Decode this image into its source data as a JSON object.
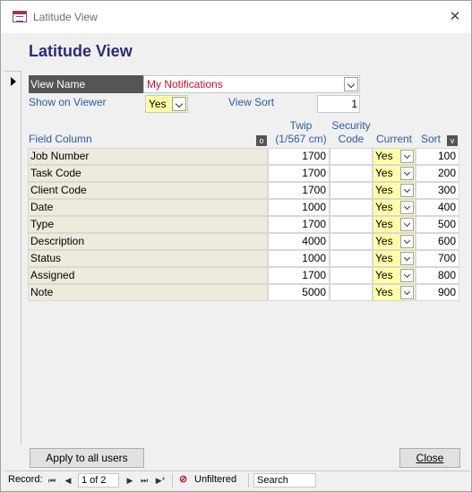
{
  "window": {
    "title": "Latitude View",
    "close_glyph": "✕"
  },
  "form": {
    "title": "Latitude View",
    "view_name_label": "View Name",
    "view_name_value": "My Notifications",
    "show_on_viewer_label": "Show on Viewer",
    "show_on_viewer_value": "Yes",
    "view_sort_label": "View Sort",
    "view_sort_value": "1"
  },
  "grid": {
    "headers": {
      "field_column": "Field Column",
      "o_button": "o",
      "twip_line1": "Twip",
      "twip_line2": "(1/567 cm)",
      "security_line1": "Security",
      "security_line2": "Code",
      "current": "Current",
      "sort": "Sort",
      "v_button": "v"
    },
    "rows": [
      {
        "field": "Job Number",
        "twip": "1700",
        "security": "",
        "current": "Yes",
        "sort": "100"
      },
      {
        "field": "Task Code",
        "twip": "1700",
        "security": "",
        "current": "Yes",
        "sort": "200"
      },
      {
        "field": "Client Code",
        "twip": "1700",
        "security": "",
        "current": "Yes",
        "sort": "300"
      },
      {
        "field": "Date",
        "twip": "1000",
        "security": "",
        "current": "Yes",
        "sort": "400"
      },
      {
        "field": "Type",
        "twip": "1700",
        "security": "",
        "current": "Yes",
        "sort": "500"
      },
      {
        "field": "Description",
        "twip": "4000",
        "security": "",
        "current": "Yes",
        "sort": "600"
      },
      {
        "field": "Status",
        "twip": "1000",
        "security": "",
        "current": "Yes",
        "sort": "700"
      },
      {
        "field": "Assigned",
        "twip": "1700",
        "security": "",
        "current": "Yes",
        "sort": "800"
      },
      {
        "field": "Note",
        "twip": "5000",
        "security": "",
        "current": "Yes",
        "sort": "900"
      }
    ]
  },
  "buttons": {
    "apply_all": "Apply to all users",
    "close": "Close"
  },
  "statusbar": {
    "record_label": "Record:",
    "first": "⏮",
    "prev": "◀",
    "record_value": "1 of 2",
    "next": "▶",
    "last": "⏭",
    "new": "▶*",
    "filter_icon": "filter-off-icon",
    "filter_label": "Unfiltered",
    "search_placeholder": "Search"
  },
  "colors": {
    "accent_title": "#2b2b7a",
    "label_blue": "#2e5aa8",
    "value_red": "#c8102e",
    "yes_fill": "#ffffa8",
    "field_fill": "#eeeadc"
  }
}
